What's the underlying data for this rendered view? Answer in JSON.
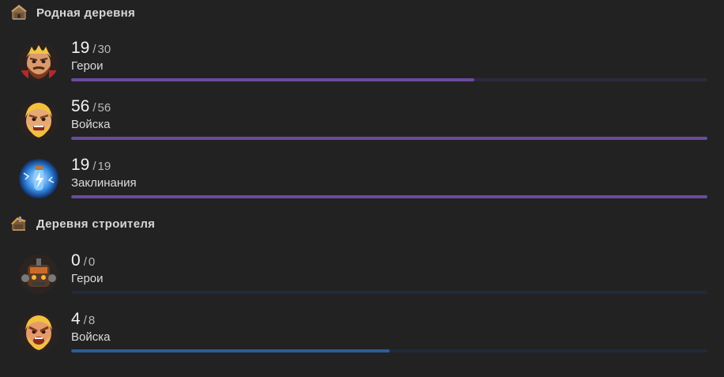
{
  "sections": [
    {
      "title": "Родная деревня",
      "icon": "home-village-icon",
      "accent": "#6a4b9c",
      "track": "#2d2a3c",
      "items": [
        {
          "icon": "barbarian-king-avatar",
          "current": "19",
          "total": "30",
          "label": "Герои",
          "progress": 0.633
        },
        {
          "icon": "barbarian-avatar",
          "current": "56",
          "total": "56",
          "label": "Войска",
          "progress": 1.0
        },
        {
          "icon": "lightning-spell-avatar",
          "current": "19",
          "total": "19",
          "label": "Заклинания",
          "progress": 1.0
        }
      ]
    },
    {
      "title": "Деревня строителя",
      "icon": "builder-base-icon",
      "accent": "#2c5d98",
      "track": "#1f2a3a",
      "items": [
        {
          "icon": "battle-machine-avatar",
          "current": "0",
          "total": "0",
          "label": "Герои",
          "progress": 0.0
        },
        {
          "icon": "raged-barbarian-avatar",
          "current": "4",
          "total": "8",
          "label": "Войска",
          "progress": 0.5
        }
      ]
    }
  ],
  "separator": "/"
}
